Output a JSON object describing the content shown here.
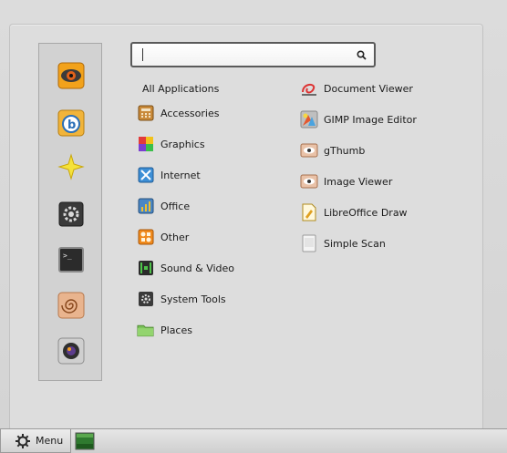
{
  "favorites": [
    {
      "name": "eye-of-gnome",
      "icon": "eye-icon"
    },
    {
      "name": "banshee",
      "icon": "banshee-icon"
    },
    {
      "name": "star",
      "icon": "star-icon"
    },
    {
      "name": "system-settings",
      "icon": "settings-icon"
    },
    {
      "name": "terminal",
      "icon": "terminal-icon"
    },
    {
      "name": "shell",
      "icon": "shell-icon"
    },
    {
      "name": "camera",
      "icon": "camera-icon"
    }
  ],
  "search": {
    "value": "",
    "placeholder": ""
  },
  "all_applications_label": "All Applications",
  "categories": [
    {
      "label": "Accessories",
      "icon": "accessories-icon"
    },
    {
      "label": "Graphics",
      "icon": "graphics-icon"
    },
    {
      "label": "Internet",
      "icon": "internet-icon"
    },
    {
      "label": "Office",
      "icon": "office-icon"
    },
    {
      "label": "Other",
      "icon": "other-icon"
    },
    {
      "label": "Sound & Video",
      "icon": "sound-video-icon"
    },
    {
      "label": "System Tools",
      "icon": "system-tools-icon"
    },
    {
      "label": "Places",
      "icon": "folder-icon"
    }
  ],
  "applications": [
    {
      "label": "Document Viewer",
      "icon": "document-viewer-icon"
    },
    {
      "label": "GIMP Image Editor",
      "icon": "gimp-icon"
    },
    {
      "label": "gThumb",
      "icon": "gthumb-icon"
    },
    {
      "label": "Image Viewer",
      "icon": "image-viewer-icon"
    },
    {
      "label": "LibreOffice Draw",
      "icon": "libreoffice-draw-icon"
    },
    {
      "label": "Simple Scan",
      "icon": "scanner-icon"
    }
  ],
  "taskbar": {
    "menu_label": "Menu"
  }
}
